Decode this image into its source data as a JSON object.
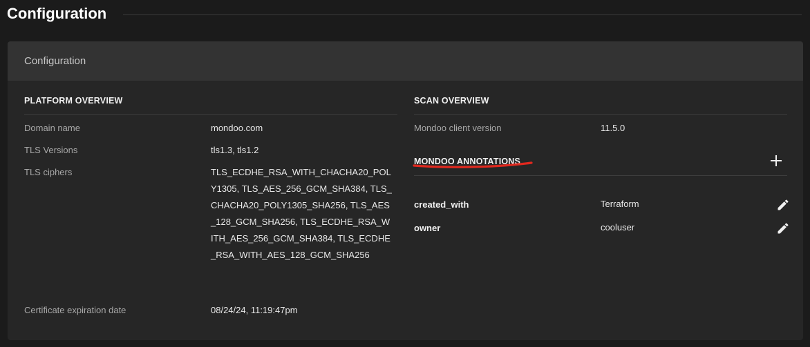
{
  "page": {
    "title": "Configuration"
  },
  "card": {
    "title": "Configuration"
  },
  "platform_overview": {
    "heading": "PLATFORM OVERVIEW",
    "rows": [
      {
        "label": "Domain name",
        "value": "mondoo.com"
      },
      {
        "label": "TLS Versions",
        "value": "tls1.3, tls1.2"
      },
      {
        "label": "TLS ciphers",
        "value": "TLS_ECDHE_RSA_WITH_CHACHA20_POLY1305, TLS_AES_256_GCM_SHA384, TLS_CHACHA20_POLY1305_SHA256, TLS_AES_128_GCM_SHA256, TLS_ECDHE_RSA_WITH_AES_256_GCM_SHA384, TLS_ECDHE_RSA_WITH_AES_128_GCM_SHA256"
      },
      {
        "label": "Certificate expiration date",
        "value": "08/24/24, 11:19:47pm"
      }
    ]
  },
  "scan_overview": {
    "heading": "SCAN OVERVIEW",
    "rows": [
      {
        "label": "Mondoo client version",
        "value": "11.5.0"
      }
    ]
  },
  "annotations": {
    "heading": "MONDOO ANNOTATIONS",
    "add_icon": "plus-icon",
    "edit_icon": "pencil-icon",
    "underline_color": "#e0281e",
    "items": [
      {
        "key": "created_with",
        "value": "Terraform"
      },
      {
        "key": "owner",
        "value": "cooluser"
      }
    ]
  },
  "colors": {
    "background": "#1b1b1b",
    "card": "#262626",
    "card_header": "#333333",
    "accent_red": "#e0281e"
  }
}
